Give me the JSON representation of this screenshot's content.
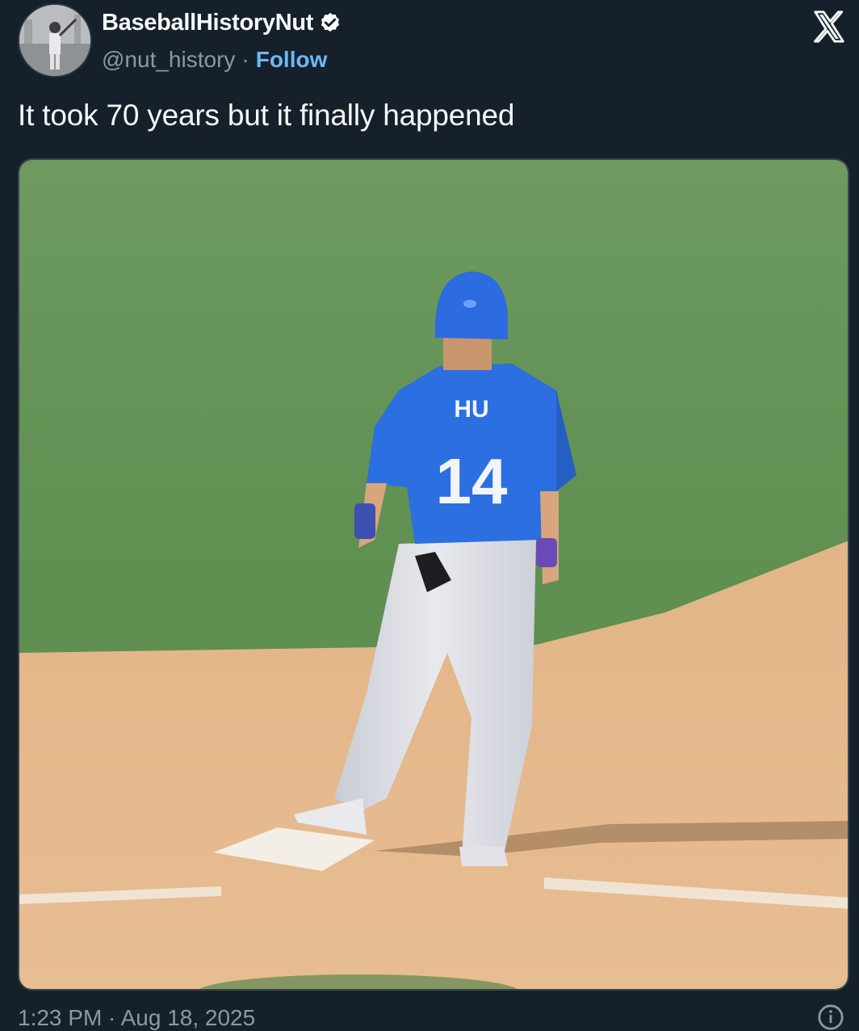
{
  "tweet": {
    "display_name": "BaseballHistoryNut",
    "handle": "@nut_history",
    "separator": "·",
    "follow_label": "Follow",
    "text": "It took 70 years but it finally happened",
    "timestamp_partial": "1:23 PM · Aug 18, 2025"
  },
  "icons": {
    "verified": "verified-badge-icon",
    "brand": "x-logo-icon",
    "info": "info-icon"
  },
  "media": {
    "jersey_name": "HU",
    "jersey_number": "14"
  },
  "colors": {
    "background": "#15202b",
    "follow": "#6cb8f5",
    "muted": "#8b98a5",
    "jersey_blue": "#2c6fe0"
  }
}
